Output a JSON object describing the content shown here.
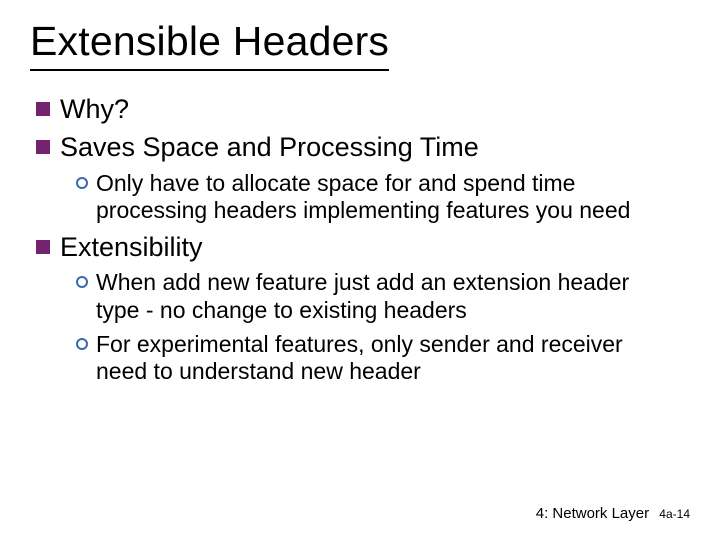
{
  "title": "Extensible Headers",
  "bullets": {
    "why": "Why?",
    "saves": "Saves Space and Processing Time",
    "saves_sub1": "Only have to allocate space for and spend time processing  headers implementing features you need",
    "ext": "Extensibility",
    "ext_sub1": "When add new feature just add an extension header type - no change to existing headers",
    "ext_sub2": "For experimental features, only sender and receiver need to understand new header"
  },
  "footer": {
    "section": "4: Network Layer",
    "page": "4a-14"
  }
}
